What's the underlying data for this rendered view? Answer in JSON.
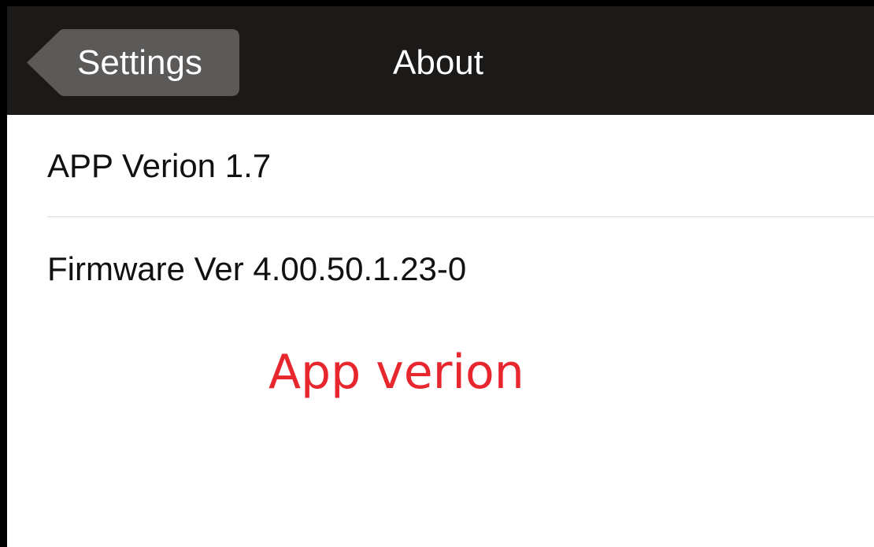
{
  "navbar": {
    "back_label": "Settings",
    "title": "About",
    "background_color": "#1c1a18",
    "back_button_color": "#5b5a58"
  },
  "list": {
    "items": [
      {
        "label": "APP Verion 1.7"
      },
      {
        "label": "Firmware Ver 4.00.50.1.23-0"
      }
    ]
  },
  "annotation": {
    "text": "App verion",
    "color": "#e8262e"
  },
  "icons": {
    "back": "back-arrow-shape"
  }
}
